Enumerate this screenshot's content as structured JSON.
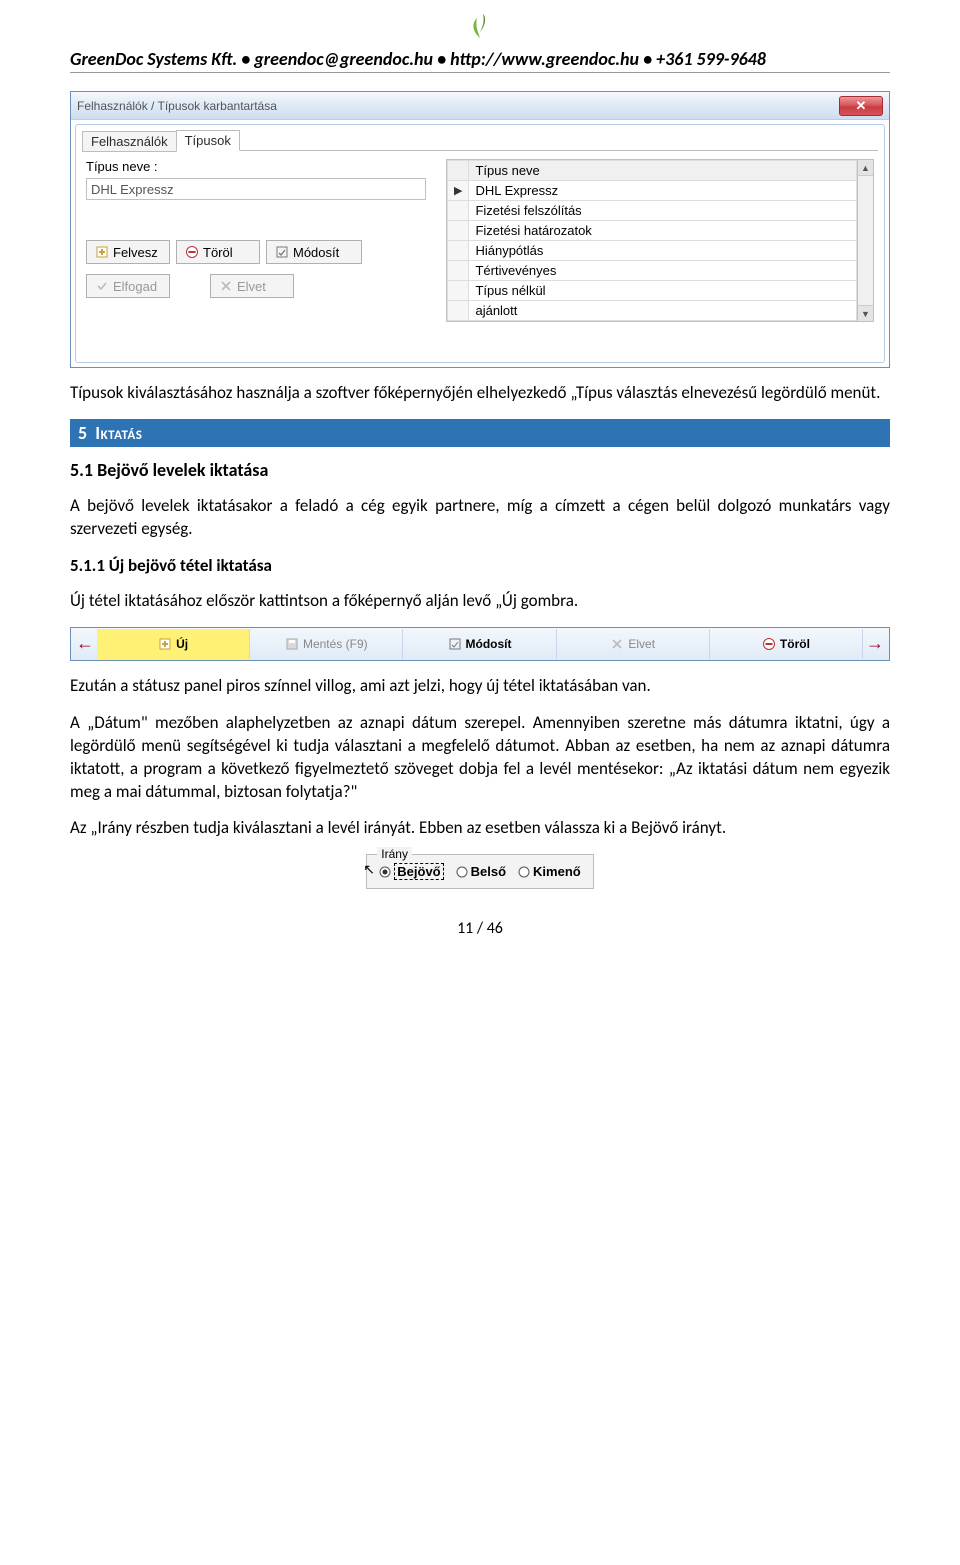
{
  "header": {
    "company": "GreenDoc Systems Kft.",
    "sep": " • ",
    "email": "greendoc@greendoc.hu",
    "url": "http://www.greendoc.hu",
    "phone": "+361 599-9648"
  },
  "dialog": {
    "title": "Felhasználók / Típusok karbantartása",
    "tabs": [
      "Felhasználók",
      "Típusok"
    ],
    "active_tab": 1,
    "field_label": "Típus neve :",
    "field_value": "DHL Expressz",
    "buttons": {
      "felvesz": "Felvesz",
      "torol": "Töröl",
      "modosit": "Módosít",
      "elfogad": "Elfogad",
      "elvet": "Elvet"
    },
    "grid_header": "Típus neve",
    "grid_rows": [
      "DHL Expressz",
      "Fizetési felszólítás",
      "Fizetési határozatok",
      "Hiánypótlás",
      "Tértivevényes",
      "Típus nélkül",
      "ajánlott"
    ],
    "grid_selected": 0
  },
  "para1": "Típusok kiválasztásához használja a szoftver főképernyőjén elhelyezkedő „Típus választás elnevezésű legördülő menüt.",
  "section5_num": "5",
  "section5_title": "Iktatás",
  "h51": "5.1 Bejövő levelek iktatása",
  "para2": "A bejövő levelek iktatásakor a feladó a cég egyik partnere, míg a címzett a cégen belül dolgozó munkatárs vagy szervezeti egység.",
  "h511": "5.1.1 Új bejövő tétel iktatása",
  "para3": "Új tétel iktatásához először kattintson a főképernyő alján levő „Új gombra.",
  "toolbar": {
    "uj": "Új",
    "mentes": "Mentés (F9)",
    "modosit": "Módosít",
    "elvet": "Elvet",
    "torol": "Töröl"
  },
  "para4": "Ezután a státusz panel piros színnel villog, ami azt jelzi, hogy új tétel iktatásában van.",
  "para5": "A „Dátum\" mezőben alaphelyzetben az aznapi dátum szerepel. Amennyiben szeretne más dátumra iktatni, úgy a legördülő menü segítségével ki tudja választani a megfelelő dátumot. Abban az esetben, ha nem az aznapi dátumra iktatott, a program a következő figyelmeztető szöveget dobja fel a levél mentésekor: „Az iktatási dátum nem egyezik meg a mai dátummal, biztosan folytatja?\"",
  "para6": "Az „Irány részben tudja kiválasztani a levél irányát. Ebben az esetben válassza ki a Bejövő irányt.",
  "irany": {
    "legend": "Irány",
    "options": [
      "Bejövő",
      "Belső",
      "Kimenő"
    ],
    "selected": 0
  },
  "page_number": "11 / 46"
}
